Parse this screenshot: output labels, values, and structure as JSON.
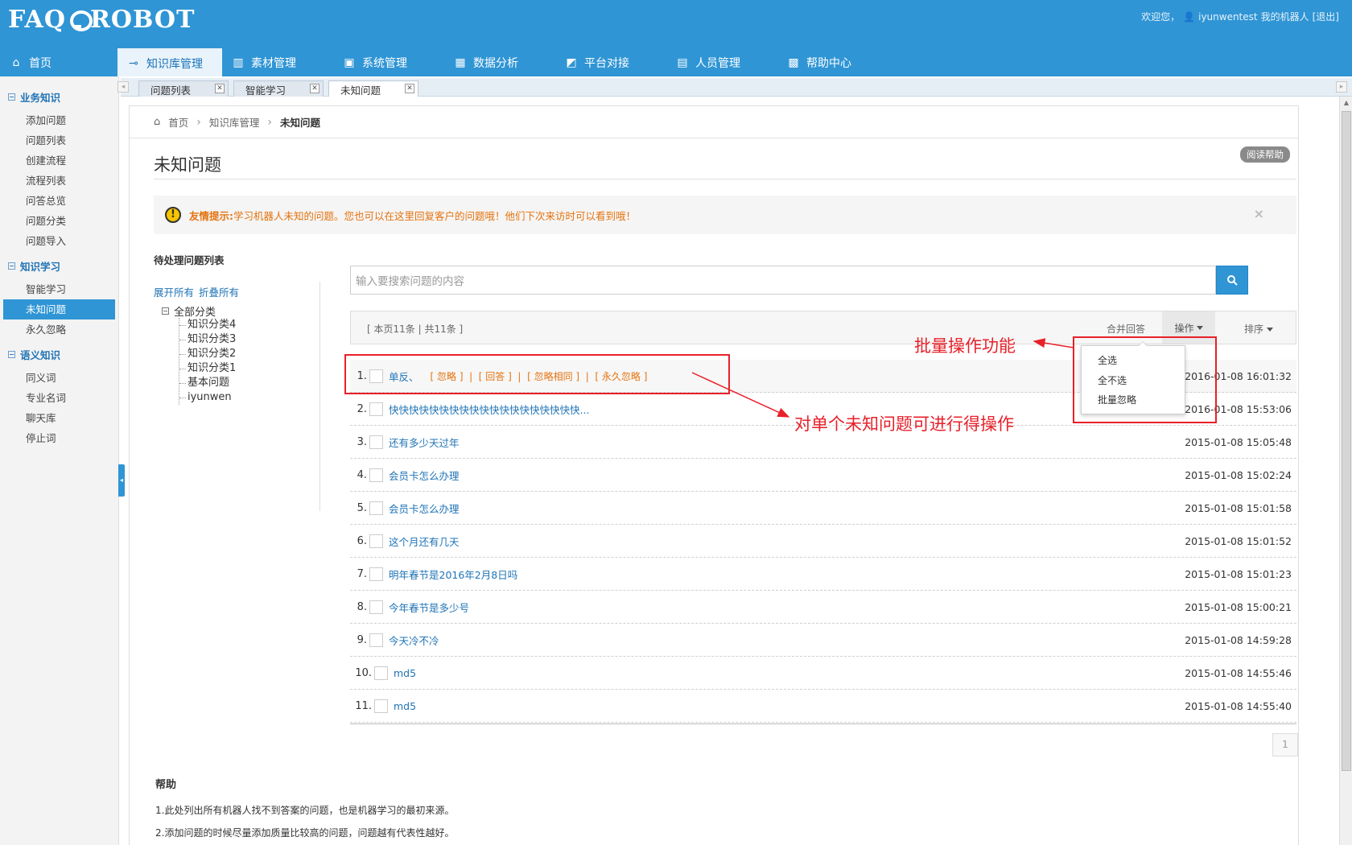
{
  "header": {
    "logo": "FAQ ROBOT",
    "welcome": "欢迎您，",
    "user": "iyunwentest",
    "my_robot": "我的机器人",
    "logout": "[退出]"
  },
  "nav": [
    {
      "label": "首页",
      "icon": "home-icon"
    },
    {
      "label": "知识库管理",
      "icon": "key-icon",
      "active": true
    },
    {
      "label": "素材管理",
      "icon": "bar-chart-icon"
    },
    {
      "label": "系统管理",
      "icon": "window-icon"
    },
    {
      "label": "数据分析",
      "icon": "grid-chart-icon"
    },
    {
      "label": "平台对接",
      "icon": "line-chart-icon"
    },
    {
      "label": "人员管理",
      "icon": "person-icon"
    },
    {
      "label": "帮助中心",
      "icon": "blocks-icon"
    }
  ],
  "sidebar": {
    "groups": [
      {
        "title": "业务知识",
        "items": [
          "添加问题",
          "问题列表",
          "创建流程",
          "流程列表",
          "问答总览",
          "问题分类",
          "问题导入"
        ]
      },
      {
        "title": "知识学习",
        "items": [
          "智能学习",
          "未知问题",
          "永久忽略"
        ]
      },
      {
        "title": "语义知识",
        "items": [
          "同义词",
          "专业名词",
          "聊天库",
          "停止词"
        ]
      }
    ],
    "active_item": "未知问题"
  },
  "tabs": [
    {
      "label": "问题列表"
    },
    {
      "label": "智能学习"
    },
    {
      "label": "未知问题",
      "active": true
    }
  ],
  "breadcrumb": {
    "home": "首页",
    "section": "知识库管理",
    "current": "未知问题"
  },
  "page": {
    "title": "未知问题",
    "help_button": "阅读帮助",
    "notice_label": "友情提示:",
    "notice_text": "学习机器人未知的问题。您也可以在这里回复客户的问题哦！他们下次来访时可以看到哦！"
  },
  "tree": {
    "title": "待处理问题列表",
    "expand_all": "展开所有",
    "collapse_all": "折叠所有",
    "root": "全部分类",
    "children": [
      "知识分类4",
      "知识分类3",
      "知识分类2",
      "知识分类1",
      "基本问题",
      "iyunwen"
    ]
  },
  "search": {
    "placeholder": "输入要搜索问题的内容"
  },
  "toolbar": {
    "count_text": "[  本页11条 | 共11条  ]",
    "merge": "合并回答",
    "ops": "操作",
    "sort": "排序"
  },
  "ops_menu": [
    "全选",
    "全不选",
    "批量忽略"
  ],
  "row_actions": "[ 忽略 ]  |  [ 回答 ]  |  [ 忽略相同 ]  |  [ 永久忽略 ]",
  "questions": [
    {
      "num": "1.",
      "text": "单反、",
      "time": "2016-01-08 16:01:32"
    },
    {
      "num": "2.",
      "text": "快快快快快快快快快快快快快快快快快快快...",
      "time": "2016-01-08 15:53:06"
    },
    {
      "num": "3.",
      "text": "还有多少天过年",
      "time": "2015-01-08 15:05:48"
    },
    {
      "num": "4.",
      "text": "会员卡怎么办理",
      "time": "2015-01-08 15:02:24"
    },
    {
      "num": "5.",
      "text": "会员卡怎么办理",
      "time": "2015-01-08 15:01:58"
    },
    {
      "num": "6.",
      "text": "这个月还有几天",
      "time": "2015-01-08 15:01:52"
    },
    {
      "num": "7.",
      "text": "明年春节是2016年2月8日吗",
      "time": "2015-01-08 15:01:23"
    },
    {
      "num": "8.",
      "text": "今年春节是多少号",
      "time": "2015-01-08 15:00:21"
    },
    {
      "num": "9.",
      "text": "今天冷不冷",
      "time": "2015-01-08 14:59:28"
    },
    {
      "num": "10.",
      "text": "md5",
      "time": "2015-01-08 14:55:46"
    },
    {
      "num": "11.",
      "text": "md5",
      "time": "2015-01-08 14:55:40"
    }
  ],
  "pager": {
    "page": "1"
  },
  "help": {
    "title": "帮助",
    "lines": [
      "1.此处列出所有机器人找不到答案的问题，也是机器学习的最初来源。",
      "2.添加问题的时候尽量添加质量比较高的问题，问题越有代表性越好。"
    ]
  },
  "annotations": {
    "batch": "批量操作功能",
    "single": "对单个未知问题可进行得操作",
    "color": "#e8202a"
  }
}
